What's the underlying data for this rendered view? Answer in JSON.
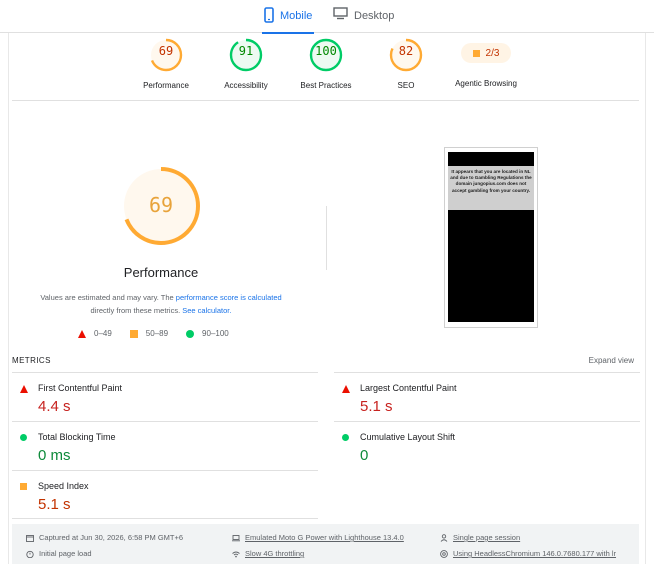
{
  "tabs": {
    "mobile": "Mobile",
    "desktop": "Desktop"
  },
  "scores": [
    {
      "value": "69",
      "label": "Performance",
      "color": "#fa3"
    },
    {
      "value": "91",
      "label": "Accessibility",
      "color": "#0c6"
    },
    {
      "value": "100",
      "label": "Best Practices",
      "color": "#0c6"
    },
    {
      "value": "82",
      "label": "SEO",
      "color": "#fa3"
    }
  ],
  "agentic": {
    "value": "2/3",
    "label": "Agentic Browsing"
  },
  "performance": {
    "score": "69",
    "title": "Performance",
    "estimate_text": "Values are estimated and may vary. The ",
    "estimate_link": "performance score is calculated",
    "estimate_mid": "directly from these metrics. ",
    "calc_link": "See calculator.",
    "legend": [
      "0–49",
      "50–89",
      "90–100"
    ]
  },
  "screenshot": {
    "message": "It appears that you are located in NL and due to Gambling Regulations the domain jungopius.com does not accept gambling from your country."
  },
  "metrics": {
    "header": "METRICS",
    "expand": "Expand view",
    "items": [
      {
        "name": "First Contentful Paint",
        "value": "4.4 s",
        "status": "fail"
      },
      {
        "name": "Largest Contentful Paint",
        "value": "5.1 s",
        "status": "fail"
      },
      {
        "name": "Total Blocking Time",
        "value": "0 ms",
        "status": "pass"
      },
      {
        "name": "Cumulative Layout Shift",
        "value": "0",
        "status": "pass"
      },
      {
        "name": "Speed Index",
        "value": "5.1 s",
        "status": "average"
      }
    ]
  },
  "footer": {
    "captured": "Captured at Jun 30, 2026, 6:58 PM GMT+6",
    "load": "Initial page load",
    "device": "Emulated Moto G Power with Lighthouse 13.4.0",
    "throttle": "Slow 4G throttling",
    "session": "Single page session",
    "browser": "Using HeadlessChromium 146.0.7680.177 with lr"
  }
}
